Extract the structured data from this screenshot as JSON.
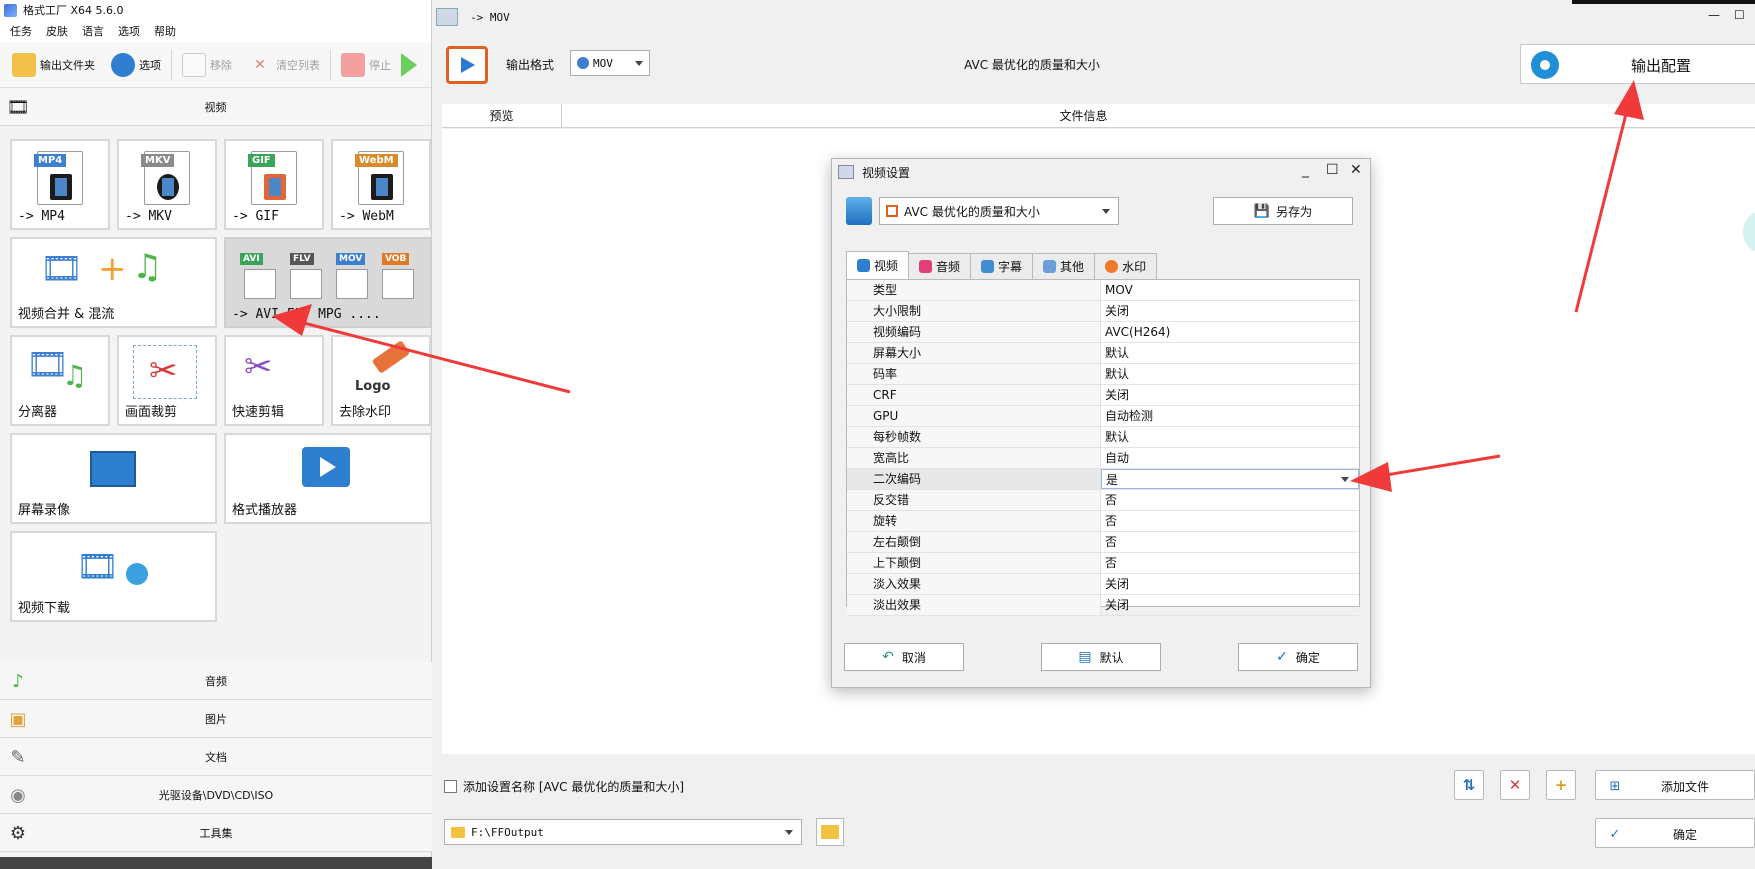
{
  "left_app": {
    "title": "格式工厂 X64 5.6.0",
    "menu": [
      "任务",
      "皮肤",
      "语言",
      "选项",
      "帮助"
    ],
    "toolbar": {
      "output_folder": "输出文件夹",
      "options": "选项",
      "remove": "移除",
      "clear_list": "清空列表",
      "stop": "停止"
    },
    "category_video": "视频",
    "tiles": {
      "mp4": "-> MP4",
      "mkv": "-> MKV",
      "gif": "-> GIF",
      "webm": "-> WebM",
      "merge": "视频合并 & 混流",
      "avi": "-> AVI FLV MPG ....",
      "splitter": "分离器",
      "crop": "画面裁剪",
      "quick_edit": "快速剪辑",
      "watermark": "去除水印",
      "screen_record": "屏幕录像",
      "player": "格式播放器",
      "download": "视频下载"
    },
    "tile_tags": {
      "mp4": "MP4",
      "mkv": "MKV",
      "gif": "GIF",
      "webm": "WebM",
      "avi": "AVI",
      "flv": "FLV",
      "mov": "MOV",
      "vob": "VOB",
      "logo": "Logo"
    },
    "categories": [
      "音频",
      "图片",
      "文档",
      "光驱设备\\DVD\\CD\\ISO",
      "工具集"
    ]
  },
  "main_window": {
    "title": "-> MOV",
    "format_label": "输出格式",
    "format_value": "MOV",
    "profile_center": "AVC 最优化的质量和大小",
    "output_config": "输出配置",
    "list_headers": {
      "preview": "预览",
      "file_info": "文件信息"
    },
    "add_setting_name": "添加设置名称 [AVC 最优化的质量和大小]",
    "add_file": "添加文件",
    "ok": "确定",
    "output_path": "F:\\FFOutput"
  },
  "dialog": {
    "title": "视频设置",
    "profile": "AVC 最优化的质量和大小",
    "save_as": "另存为",
    "tabs": [
      "视频",
      "音频",
      "字幕",
      "其他",
      "水印"
    ],
    "rows": [
      {
        "key": "类型",
        "value": "MOV"
      },
      {
        "key": "大小限制",
        "value": "关闭"
      },
      {
        "key": "视频编码",
        "value": "AVC(H264)"
      },
      {
        "key": "屏幕大小",
        "value": "默认"
      },
      {
        "key": "码率",
        "value": "默认"
      },
      {
        "key": "CRF",
        "value": "关闭"
      },
      {
        "key": "GPU",
        "value": "自动检测"
      },
      {
        "key": "每秒帧数",
        "value": "默认"
      },
      {
        "key": "宽高比",
        "value": "自动"
      },
      {
        "key": "二次编码",
        "value": "是"
      },
      {
        "key": "反交错",
        "value": "否"
      },
      {
        "key": "旋转",
        "value": "否"
      },
      {
        "key": "左右颠倒",
        "value": "否"
      },
      {
        "key": "上下颠倒",
        "value": "否"
      },
      {
        "key": "淡入效果",
        "value": "关闭"
      },
      {
        "key": "淡出效果",
        "value": "关闭"
      }
    ],
    "buttons": {
      "cancel": "取消",
      "default": "默认",
      "ok": "确定"
    }
  },
  "colors": {
    "annotation_arrow": "#f03a3a",
    "accent_blue": "#1f8fd8",
    "format_orange": "#e0611f"
  }
}
